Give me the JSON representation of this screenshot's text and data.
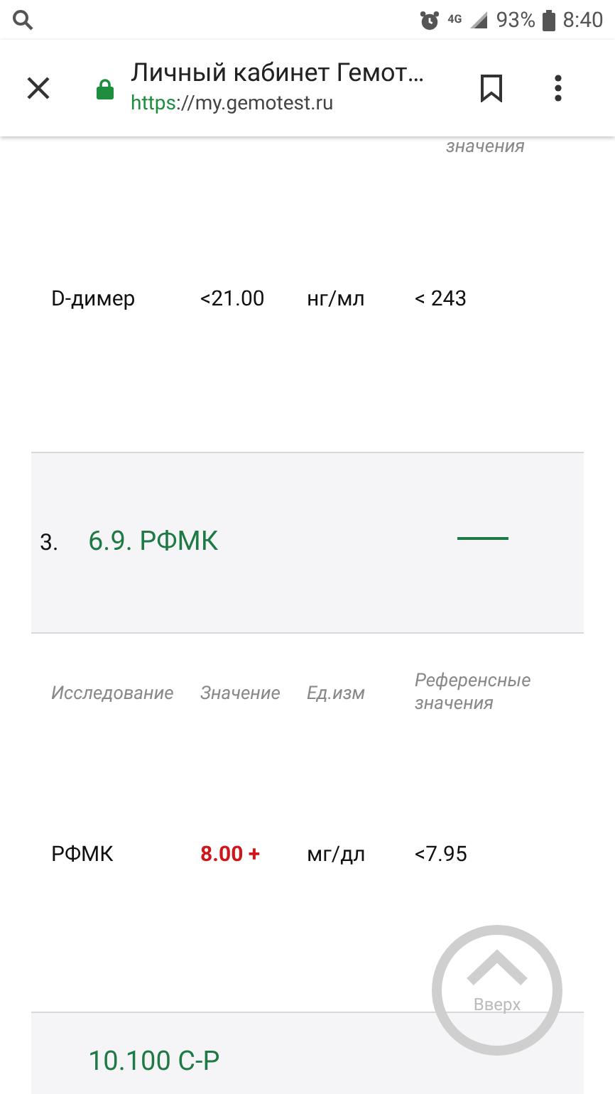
{
  "status_bar": {
    "network": "4G",
    "battery": "93%",
    "time": "8:40"
  },
  "browser": {
    "title": "Личный кабинет Гемот…",
    "url_scheme": "https",
    "url_rest": "://my.gemotest.ru"
  },
  "top_fragment": {
    "reference_heading_tail": "значения",
    "row": {
      "test": "D-димер",
      "value": "<21.00",
      "unit": "нг/мл",
      "reference": "< 243",
      "abnormal": false
    }
  },
  "sections": [
    {
      "number": "3.",
      "title": "6.9. РФМК",
      "expanded": true,
      "columns": [
        "Исследование",
        "Значение",
        "Ед.изм",
        "Референсные значения"
      ],
      "rows": [
        {
          "test": "РФМК",
          "value": "8.00 +",
          "unit": "мг/дл",
          "reference": "<7.95",
          "abnormal": true
        }
      ]
    }
  ],
  "next_section": {
    "title": "10.100 С-Р"
  },
  "scroll_top": {
    "label": "Вверх"
  }
}
